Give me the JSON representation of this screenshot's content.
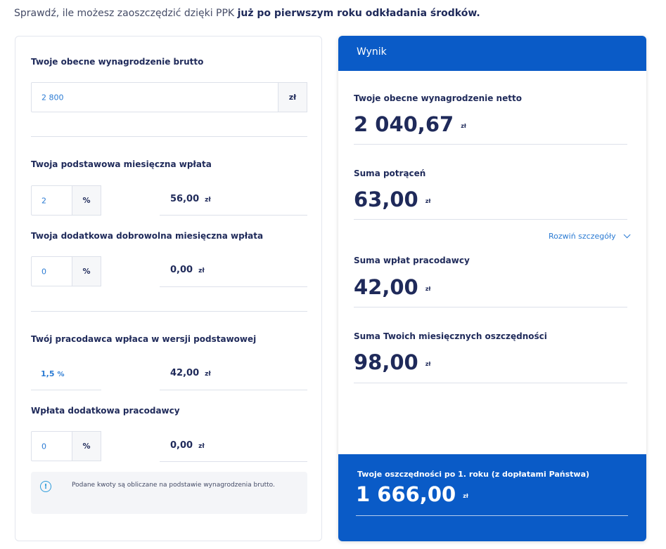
{
  "intro": {
    "text_regular": "Sprawdź, ile możesz zaoszczędzić dzięki PPK ",
    "text_bold": "już po pierwszym roku odkładania środków."
  },
  "left": {
    "salary": {
      "label": "Twoje obecne wynagrodzenie brutto",
      "value": "2 800",
      "unit": "zł"
    },
    "basic_contribution": {
      "label": "Twoja podstawowa miesięczna wpłata",
      "percent": "2",
      "unit": "%",
      "amount": "56,00",
      "currency": "zł"
    },
    "additional_contribution": {
      "label": "Twoja dodatkowa dobrowolna miesięczna wpłata",
      "percent": "0",
      "unit": "%",
      "amount": "0,00",
      "currency": "zł"
    },
    "employer_basic": {
      "label": "Twój pracodawca wpłaca w wersji podstawowej",
      "percent": "1,5",
      "unit": "%",
      "amount": "42,00",
      "currency": "zł"
    },
    "employer_additional": {
      "label": "Wpłata dodatkowa pracodawcy",
      "percent": "0",
      "unit": "%",
      "amount": "0,00",
      "currency": "zł"
    },
    "info": "Podane kwoty są obliczane na podstawie wynagrodzenia brutto."
  },
  "right": {
    "header": "Wynik",
    "net_salary": {
      "label": "Twoje obecne wynagrodzenie netto",
      "value": "2 040,67",
      "currency": "zł"
    },
    "deductions": {
      "label": "Suma potrąceń",
      "value": "63,00",
      "currency": "zł"
    },
    "expand_label": "Rozwiń szczegóły",
    "employer_sum": {
      "label": "Suma wpłat pracodawcy",
      "value": "42,00",
      "currency": "zł"
    },
    "monthly_savings": {
      "label": "Suma Twoich miesięcznych oszczędności",
      "value": "98,00",
      "currency": "zł"
    },
    "yearly_savings": {
      "label": "Twoje oszczędności po 1. roku (z dopłatami Państwa)",
      "value": "1 666,00",
      "currency": "zł"
    }
  },
  "colors": {
    "accent": "#0a5bc7",
    "link": "#2b7bd3",
    "text": "#1f2a5a"
  }
}
